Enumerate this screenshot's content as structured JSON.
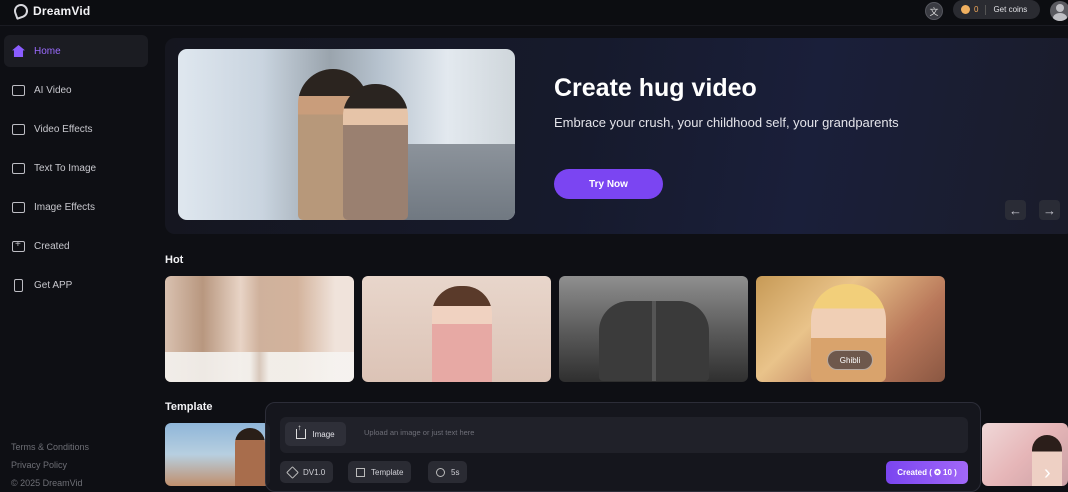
{
  "app": {
    "name": "DreamVid"
  },
  "header": {
    "coin_count": "0",
    "get_coins_label": "Get coins",
    "lang_icon": "translate-icon"
  },
  "sidebar": {
    "items": [
      {
        "label": "Home",
        "icon": "home-icon",
        "active": true
      },
      {
        "label": "AI Video",
        "icon": "ai-video-icon"
      },
      {
        "label": "Video Effects",
        "icon": "video-effects-icon"
      },
      {
        "label": "Text To Image",
        "icon": "text-to-image-icon"
      },
      {
        "label": "Image Effects",
        "icon": "image-effects-icon"
      },
      {
        "label": "Created",
        "icon": "created-icon"
      },
      {
        "label": "Get APP",
        "icon": "phone-icon"
      }
    ],
    "footer": {
      "terms": "Terms & Conditions",
      "privacy": "Privacy Policy",
      "copyright": "© 2025 DreamVid"
    }
  },
  "hero": {
    "title": "Create hug video",
    "subtitle": "Embrace your crush, your childhood self, your grandparents",
    "cta": "Try Now",
    "prev": "←",
    "next": "→"
  },
  "sections": {
    "hot": "Hot",
    "template": "Template"
  },
  "hot_cards": [
    {
      "tag": ""
    },
    {
      "tag": ""
    },
    {
      "tag": ""
    },
    {
      "tag": "Ghibli"
    }
  ],
  "composer": {
    "image_button": "Image",
    "placeholder": "Upload an image or just text here",
    "model": "DV1.0",
    "template": "Template",
    "duration": "5s",
    "submit": "Created ( ✪ 10 )"
  },
  "colors": {
    "accent": "#7b45f2",
    "coin": "#f2a85a",
    "background": "#0e0f14"
  }
}
